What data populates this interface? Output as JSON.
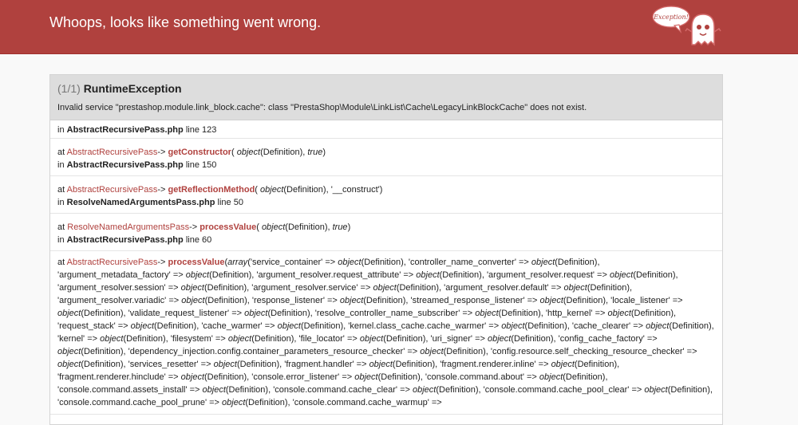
{
  "header": {
    "title": "Whoops, looks like something went wrong.",
    "ghost_text": "Exception!"
  },
  "exception": {
    "count": "(1/1)",
    "name": "RuntimeException",
    "message": "Invalid service \"prestashop.module.link_block.cache\": class \"PrestaShop\\Module\\LinkList\\Cache\\LegacyLinkBlockCache\" does not exist."
  },
  "trace": {
    "first": {
      "in": "in",
      "file": "AbstractRecursivePass.php",
      "line": "line 123"
    },
    "frames": [
      {
        "at": "at",
        "class": "AbstractRecursivePass",
        "arrow": "->",
        "method": "getConstructor",
        "args_open": "(",
        "arg1_kw": "object",
        "arg1_val": "(Definition), ",
        "arg2_kw": "true",
        "args_close": ")",
        "in": "in",
        "file": "AbstractRecursivePass.php",
        "line": "line 150"
      },
      {
        "at": "at",
        "class": "AbstractRecursivePass",
        "arrow": "->",
        "method": "getReflectionMethod",
        "args_open": "(",
        "arg1_kw": "object",
        "arg1_val": "(Definition), '__construct')",
        "in": "in",
        "file": "ResolveNamedArgumentsPass.php",
        "line": "line 50"
      },
      {
        "at": "at",
        "class": "ResolveNamedArgumentsPass",
        "arrow": "->",
        "method": "processValue",
        "args_open": "(",
        "arg1_kw": "object",
        "arg1_val": "(Definition), ",
        "arg2_kw": "true",
        "args_close": ")",
        "in": "in",
        "file": "AbstractRecursivePass.php",
        "line": "line 60"
      }
    ],
    "last": {
      "at": "at",
      "class": "AbstractRecursivePass",
      "arrow": "->",
      "method": "processValue",
      "args_open": "(",
      "array_kw": "array",
      "args": [
        [
          "'service_container' => ",
          "object",
          "(Definition), "
        ],
        [
          "'controller_name_converter' => ",
          "object",
          "(Definition), "
        ],
        [
          "'argument_metadata_factory' => ",
          "object",
          "(Definition), "
        ],
        [
          "'argument_resolver.request_attribute' => ",
          "object",
          "(Definition), "
        ],
        [
          "'argument_resolver.request' => ",
          "object",
          "(Definition), "
        ],
        [
          "'argument_resolver.session' => ",
          "object",
          "(Definition), "
        ],
        [
          "'argument_resolver.service' => ",
          "object",
          "(Definition), "
        ],
        [
          "'argument_resolver.default' => ",
          "object",
          "(Definition), "
        ],
        [
          "'argument_resolver.variadic' => ",
          "object",
          "(Definition), "
        ],
        [
          "'response_listener' => ",
          "object",
          "(Definition), "
        ],
        [
          "'streamed_response_listener' => ",
          "object",
          "(Definition), "
        ],
        [
          "'locale_listener' => ",
          "object",
          "(Definition), "
        ],
        [
          "'validate_request_listener' => ",
          "object",
          "(Definition), "
        ],
        [
          "'resolve_controller_name_subscriber' => ",
          "object",
          "(Definition), "
        ],
        [
          "'http_kernel' => ",
          "object",
          "(Definition), "
        ],
        [
          "'request_stack' => ",
          "object",
          "(Definition), "
        ],
        [
          "'cache_warmer' => ",
          "object",
          "(Definition), "
        ],
        [
          "'kernel.class_cache.cache_warmer' => ",
          "object",
          "(Definition), "
        ],
        [
          "'cache_clearer' => ",
          "object",
          "(Definition), "
        ],
        [
          "'kernel' => ",
          "object",
          "(Definition), "
        ],
        [
          "'filesystem' => ",
          "object",
          "(Definition), "
        ],
        [
          "'file_locator' => ",
          "object",
          "(Definition), "
        ],
        [
          "'uri_signer' => ",
          "object",
          "(Definition), "
        ],
        [
          "'config_cache_factory' => ",
          "object",
          "(Definition), "
        ],
        [
          "'dependency_injection.config.container_parameters_resource_checker' => ",
          "object",
          "(Definition), "
        ],
        [
          "'config.resource.self_checking_resource_checker' => ",
          "object",
          "(Definition), "
        ],
        [
          "'services_resetter' => ",
          "object",
          "(Definition), "
        ],
        [
          "'fragment.handler' => ",
          "object",
          "(Definition), "
        ],
        [
          "'fragment.renderer.inline' => ",
          "object",
          "(Definition), "
        ],
        [
          "'fragment.renderer.hinclude' => ",
          "object",
          "(Definition), "
        ],
        [
          "'console.error_listener' => ",
          "object",
          "(Definition), "
        ],
        [
          "'console.command.about' => ",
          "object",
          "(Definition), "
        ],
        [
          "'console.command.assets_install' => ",
          "object",
          "(Definition), "
        ],
        [
          "'console.command.cache_clear' => ",
          "object",
          "(Definition), "
        ],
        [
          "'console.command.cache_pool_clear' => ",
          "object",
          "(Definition), "
        ],
        [
          "'console.command.cache_pool_prune' => ",
          "object",
          "(Definition), "
        ],
        [
          "'console.command.cache_warmup' => ",
          "",
          ""
        ]
      ]
    }
  }
}
